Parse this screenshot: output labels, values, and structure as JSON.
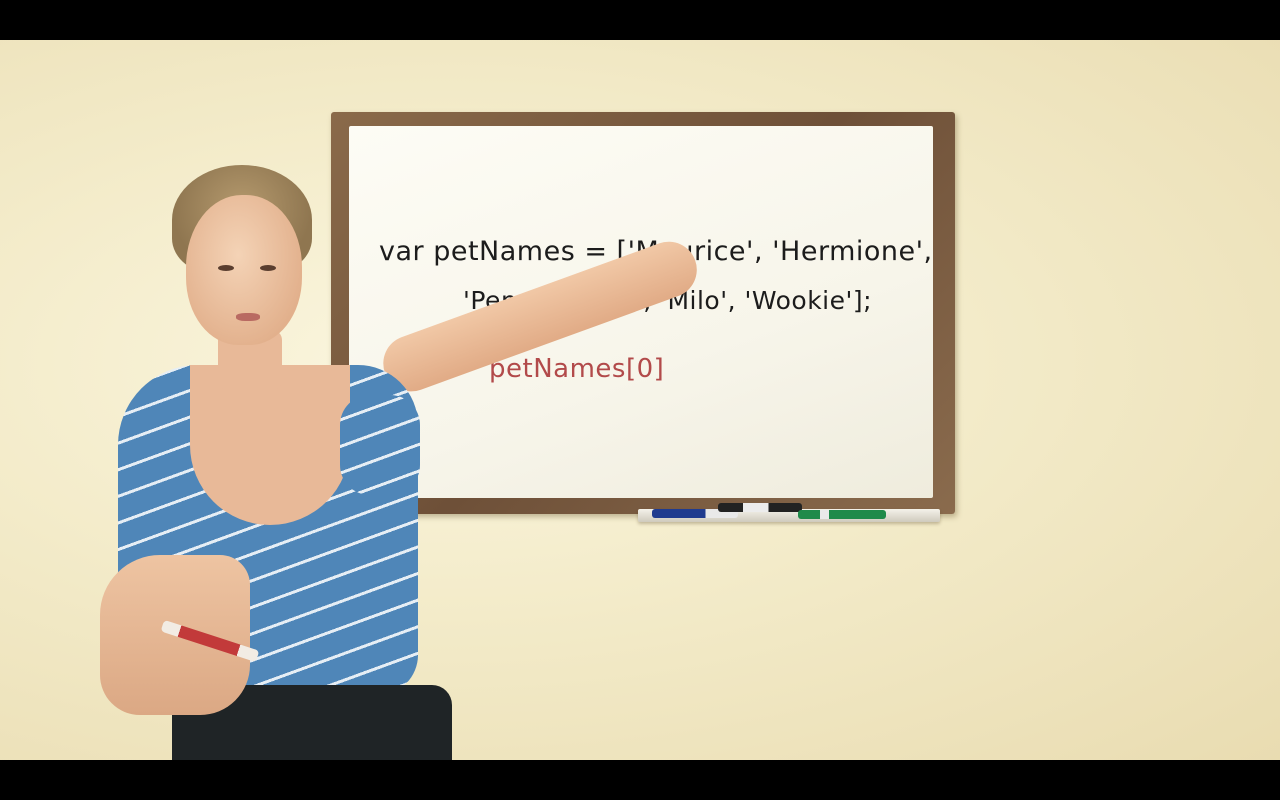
{
  "whiteboard": {
    "line1": "var petNames = ['Maurice', 'Hermione',",
    "line2": "'Penny', 'Kobi', 'Milo', 'Wookie'];",
    "line3": "petNames[0]"
  },
  "colors": {
    "code_ink": "#1c1c1c",
    "accent_ink": "#b24a4a",
    "wall": "#f3ebc9",
    "board_frame": "#7a5b40",
    "shirt": "#4f86b8"
  }
}
